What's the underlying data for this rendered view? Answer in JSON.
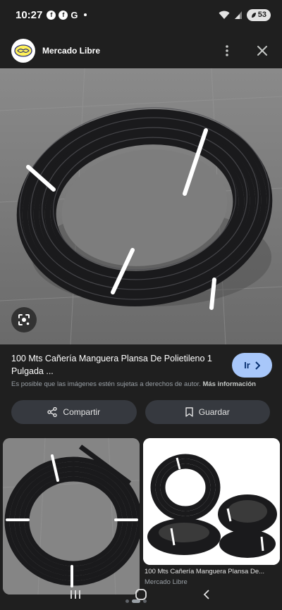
{
  "status": {
    "time": "10:27",
    "notif_g": "G",
    "battery": "53"
  },
  "header": {
    "site_name": "Mercado Libre"
  },
  "product": {
    "title": "100 Mts Cañería Manguera Plansa De Polietileno 1 Pulgada ...",
    "go_label": "Ir",
    "copyright_text": "Es posible que las imágenes estén sujetas a derechos de autor.",
    "more_info_label": "Más información"
  },
  "actions": {
    "share_label": "Compartir",
    "save_label": "Guardar"
  },
  "related": {
    "right_title": "100 Mts Cañería Manguera Plansa De...",
    "right_source": "Mercado Libre"
  },
  "icons": {
    "lens": "google-lens-icon",
    "share": "share-icon",
    "save": "bookmark-icon",
    "close": "close-icon",
    "menu": "more-vert-icon"
  },
  "colors": {
    "background": "#1f1f1f",
    "go_button": "#a8c7fa",
    "pill_button": "#36393f"
  }
}
